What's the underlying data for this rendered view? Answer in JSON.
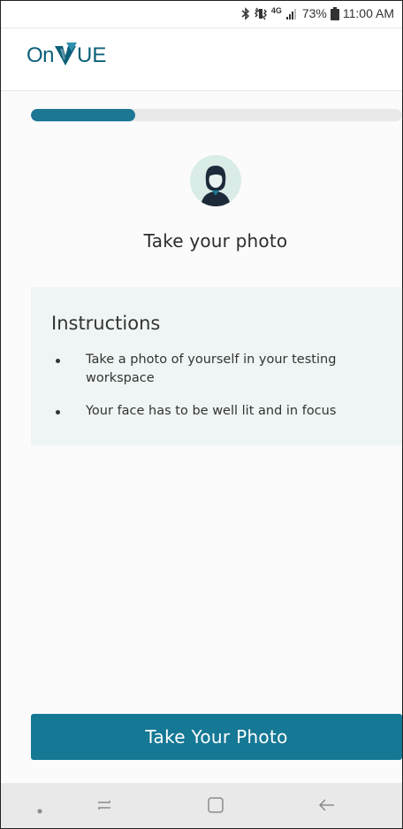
{
  "status_bar": {
    "battery_percent": "73%",
    "time": "11:00 AM",
    "network_label": "4G"
  },
  "header": {
    "logo_prefix": "On",
    "logo_suffix": "UE"
  },
  "progress": {
    "fraction": 0.28
  },
  "page": {
    "title": "Take your photo"
  },
  "instructions": {
    "heading": "Instructions",
    "items": [
      "Take a photo of yourself in your testing workspace",
      "Your face has to be well lit and in focus"
    ]
  },
  "actions": {
    "take_photo_label": "Take Your Photo"
  },
  "icons": {
    "bluetooth": "bluetooth-icon",
    "mute": "vibrate-mute-icon",
    "signal": "signal-strength-icon",
    "battery": "battery-icon",
    "avatar": "user-avatar-icon",
    "nav_dot": "nav-dot-icon",
    "recent": "recent-apps-icon",
    "home": "home-icon",
    "back": "back-icon"
  },
  "colors": {
    "brand": "#157895",
    "progress_track": "#e9e9e9",
    "avatar_bg": "#d9ece8",
    "card_bg": "#eff5f4"
  }
}
